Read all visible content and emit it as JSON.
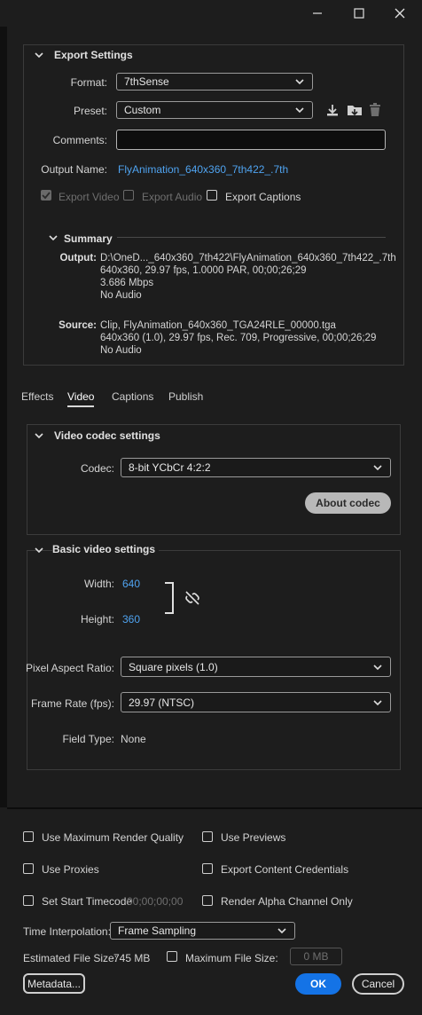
{
  "window": {
    "min_icon": "minimize-icon",
    "max_icon": "maximize-icon",
    "close_icon": "close-icon"
  },
  "export_settings": {
    "title": "Export Settings",
    "format_label": "Format:",
    "format_value": "7thSense",
    "preset_label": "Preset:",
    "preset_value": "Custom",
    "comments_label": "Comments:",
    "comments_value": "",
    "output_name_label": "Output Name:",
    "output_name_value": "FlyAnimation_640x360_7th422_.7th",
    "export_video": "Export Video",
    "export_audio": "Export Audio",
    "export_captions": "Export Captions",
    "export_video_checked": true,
    "export_audio_checked": false,
    "export_captions_checked": false
  },
  "summary": {
    "title": "Summary",
    "output_label": "Output:",
    "output_lines": [
      "D:\\OneD..._640x360_7th422\\FlyAnimation_640x360_7th422_.7th",
      "640x360, 29.97 fps, 1.0000 PAR, 00;00;26;29",
      "3.686 Mbps",
      "No Audio"
    ],
    "source_label": "Source:",
    "source_lines": [
      "Clip, FlyAnimation_640x360_TGA24RLE_00000.tga",
      "640x360 (1.0), 29.97 fps, Rec. 709, Progressive, 00;00;26;29",
      "No Audio"
    ]
  },
  "tabs": [
    "Effects",
    "Video",
    "Captions",
    "Publish"
  ],
  "active_tab": "Video",
  "codec": {
    "title": "Video codec settings",
    "codec_label": "Codec:",
    "codec_value": "8-bit YCbCr 4:2:2",
    "about_button": "About codec"
  },
  "basic": {
    "title": "Basic video settings",
    "width_label": "Width:",
    "width_value": "640",
    "height_label": "Height:",
    "height_value": "360",
    "par_label": "Pixel Aspect Ratio:",
    "par_value": "Square pixels (1.0)",
    "fps_label": "Frame Rate (fps):",
    "fps_value": "29.97 (NTSC)",
    "field_label": "Field Type:",
    "field_value": "None"
  },
  "bottom": {
    "max_render": "Use Maximum Render Quality",
    "use_previews": "Use Previews",
    "use_proxies": "Use Proxies",
    "content_credentials": "Export Content Credentials",
    "start_timecode": "Set Start Timecode",
    "start_timecode_value": "00;00;00;00",
    "alpha_only": "Render Alpha Channel Only",
    "time_interp_label": "Time Interpolation:",
    "time_interp_value": "Frame Sampling",
    "est_size_label": "Estimated File Size:",
    "est_size_value": "745 MB",
    "max_file_size": "Maximum File Size:",
    "max_file_size_value": "0 MB",
    "metadata_button": "Metadata...",
    "ok_button": "OK",
    "cancel_button": "Cancel"
  },
  "colors": {
    "accent": "#1473e6",
    "link": "#4fa3f0",
    "bg": "#1d1d1d"
  }
}
